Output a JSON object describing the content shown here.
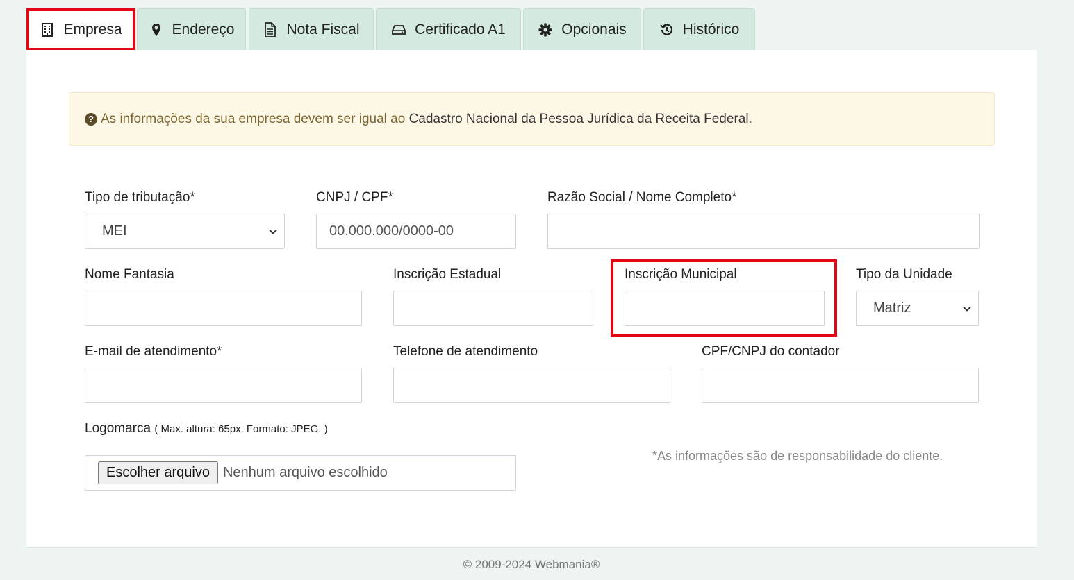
{
  "tabs": [
    {
      "label": "Empresa",
      "icon": "building-icon",
      "active": true
    },
    {
      "label": "Endereço",
      "icon": "map-marker-icon"
    },
    {
      "label": "Nota Fiscal",
      "icon": "document-icon"
    },
    {
      "label": "Certificado A1",
      "icon": "hard-drive-icon"
    },
    {
      "label": "Opcionais",
      "icon": "gear-icon"
    },
    {
      "label": "Histórico",
      "icon": "history-icon"
    }
  ],
  "alert": {
    "icon": "question-circle-icon",
    "text_muted": "As informações da sua empresa devem ser igual ao",
    "text_dark": "Cadastro Nacional da Pessoa Jurídica da Receita Federal",
    "suffix": "."
  },
  "form": {
    "tipo_tributacao": {
      "label": "Tipo de tributação*",
      "value": "MEI"
    },
    "cnpj_cpf": {
      "label": "CNPJ / CPF*",
      "placeholder": "00.000.000/0000-00"
    },
    "razao_social": {
      "label": "Razão Social / Nome Completo*",
      "value": ""
    },
    "nome_fantasia": {
      "label": "Nome Fantasia",
      "value": ""
    },
    "inscricao_estadual": {
      "label": "Inscrição Estadual",
      "value": ""
    },
    "inscricao_municipal": {
      "label": "Inscrição Municipal",
      "value": ""
    },
    "tipo_unidade": {
      "label": "Tipo da Unidade",
      "value": "Matriz"
    },
    "email": {
      "label": "E-mail de atendimento*",
      "value": ""
    },
    "telefone": {
      "label": "Telefone de atendimento",
      "value": ""
    },
    "cpf_cnpj_contador": {
      "label": "CPF/CNPJ do contador",
      "value": ""
    },
    "logomarca": {
      "label": "Logomarca",
      "hint": "( Max. altura: 65px. Formato: JPEG. )",
      "button": "Escolher arquivo",
      "status": "Nenhum arquivo escolhido"
    },
    "note": "*As informações são de responsabilidade do cliente."
  },
  "footer": "© 2009-2024 Webmania®",
  "colors": {
    "highlight": "#e30613",
    "tab_bg": "#d4e9df",
    "page_bg": "#eef4f1",
    "alert_bg": "#fdf8e6"
  }
}
